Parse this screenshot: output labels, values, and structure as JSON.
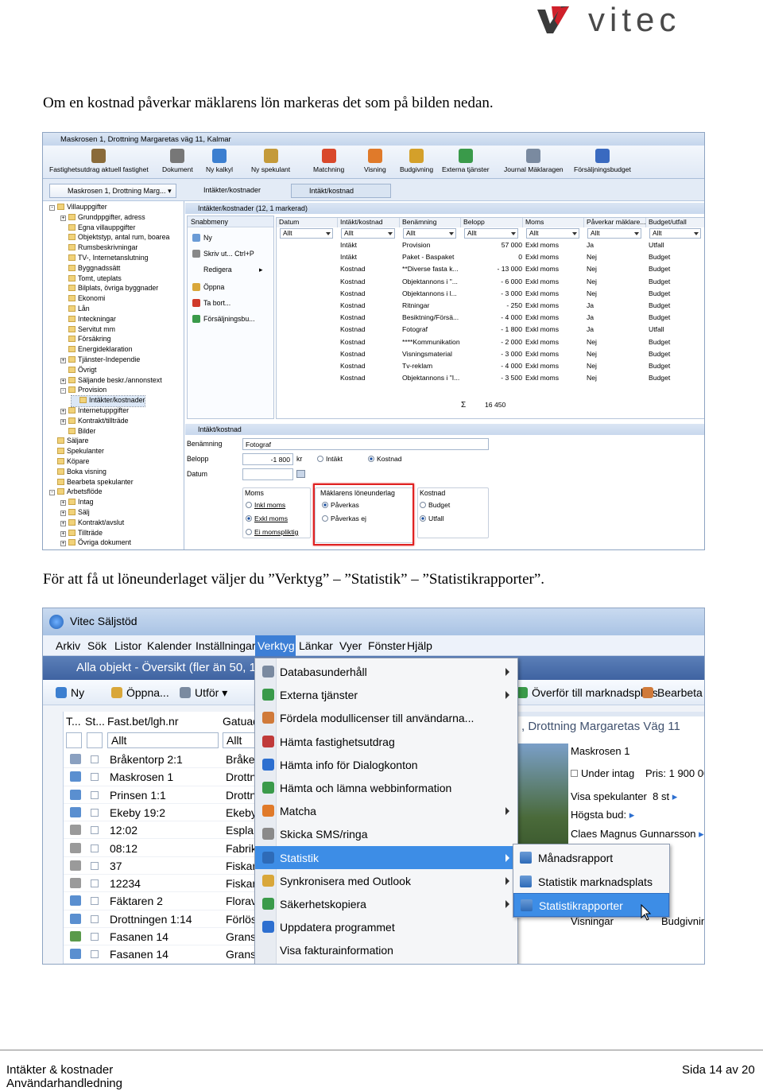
{
  "logo": {
    "text": "vitec",
    "brand_color": "#d0202a",
    "text_color": "#4a4a4a"
  },
  "paragraph_1": "Om en kostnad påverkar mäklarens lön markeras det som på bilden nedan.",
  "paragraph_2": "För att få ut löneunderlaget väljer du ”Verktyg” – ”Statistik” – ”Statistikrapporter”.",
  "shot1": {
    "title": "Maskrosen 1, Drottning Margaretas väg 11, Kalmar",
    "toolbar": [
      "Fastighetsutdrag aktuell fastighet",
      "Dokument",
      "Ny kalkyl",
      "Ny spekulant",
      "Matchning",
      "Visning",
      "Budgivning",
      "Externa tjänster",
      "Journal Mäklaragen",
      "Försäljningsbudget"
    ],
    "nav_object": "Maskrosen 1, Drottning Marg...",
    "nav_tab1": "Intäkter/kostnader",
    "nav_tab2": "Intäkt/kostnad",
    "tree": [
      {
        "label": "Villauppgifter",
        "lvl": 0,
        "box": "-"
      },
      {
        "label": "Grundppgifter, adress",
        "lvl": 1,
        "box": "+"
      },
      {
        "label": "Egna villauppgifter",
        "lvl": 1,
        "box": ""
      },
      {
        "label": "Objektstyp, antal rum, boarea",
        "lvl": 1,
        "box": ""
      },
      {
        "label": "Rumsbeskrivningar",
        "lvl": 1,
        "box": ""
      },
      {
        "label": "TV-, Internetanslutning",
        "lvl": 1,
        "box": ""
      },
      {
        "label": "Byggnadssätt",
        "lvl": 1,
        "box": ""
      },
      {
        "label": "Tomt, uteplats",
        "lvl": 1,
        "box": ""
      },
      {
        "label": "Bilplats, övriga byggnader",
        "lvl": 1,
        "box": ""
      },
      {
        "label": "Ekonomi",
        "lvl": 1,
        "box": ""
      },
      {
        "label": "Lån",
        "lvl": 1,
        "box": ""
      },
      {
        "label": "Inteckningar",
        "lvl": 1,
        "box": ""
      },
      {
        "label": "Servitut mm",
        "lvl": 1,
        "box": ""
      },
      {
        "label": "Försäkring",
        "lvl": 1,
        "box": ""
      },
      {
        "label": "Energideklaration",
        "lvl": 1,
        "box": ""
      },
      {
        "label": "Tjänster-Independie",
        "lvl": 1,
        "box": "+"
      },
      {
        "label": "Övrigt",
        "lvl": 1,
        "box": ""
      },
      {
        "label": "Säljande beskr./annonstext",
        "lvl": 1,
        "box": "+"
      },
      {
        "label": "Provision",
        "lvl": 1,
        "box": "-"
      },
      {
        "label": "Intäkter/kostnader",
        "lvl": 2,
        "box": ""
      },
      {
        "label": "Internetuppgifter",
        "lvl": 1,
        "box": "+"
      },
      {
        "label": "Kontrakt/tillträde",
        "lvl": 1,
        "box": "+"
      },
      {
        "label": "Bilder",
        "lvl": 1,
        "box": ""
      },
      {
        "label": "Säljare",
        "lvl": 0,
        "box": ""
      },
      {
        "label": "Spekulanter",
        "lvl": 0,
        "box": ""
      },
      {
        "label": "Köpare",
        "lvl": 0,
        "box": ""
      },
      {
        "label": "Boka visning",
        "lvl": 0,
        "box": ""
      },
      {
        "label": "Bearbeta spekulanter",
        "lvl": 0,
        "box": ""
      },
      {
        "label": "Arbetsflöde",
        "lvl": 0,
        "box": "-"
      },
      {
        "label": "Intag",
        "lvl": 1,
        "box": "+"
      },
      {
        "label": "Sälj",
        "lvl": 1,
        "box": "+"
      },
      {
        "label": "Kontrakt/avslut",
        "lvl": 1,
        "box": "+"
      },
      {
        "label": "Tillträde",
        "lvl": 1,
        "box": "+"
      },
      {
        "label": "Övriga dokument",
        "lvl": 1,
        "box": "+"
      }
    ],
    "subhead": "Intäkter/kostnader (12, 1 markerad)",
    "quick_title": "Snabbmeny",
    "quick": [
      "Ny",
      "Skriv ut...  Ctrl+P",
      "Redigera",
      "Öppna",
      "Ta bort...",
      "Försäljningsbu..."
    ],
    "grid_headers": [
      "Datum",
      "Intäkt/kostnad",
      "Benämning",
      "Belopp",
      "Moms",
      "Påverkar mäklare...",
      "Budget/utfall"
    ],
    "filter": "Allt",
    "grid_rows": [
      [
        "Intäkt",
        "Provision",
        "57 000",
        "Exkl moms",
        "Ja",
        "Utfall"
      ],
      [
        "Intäkt",
        "Paket - Baspaket",
        "0",
        "Exkl moms",
        "Nej",
        "Budget"
      ],
      [
        "Kostnad",
        "**Diverse fasta k...",
        "- 13 000",
        "Exkl moms",
        "Nej",
        "Budget"
      ],
      [
        "Kostnad",
        "Objektannons i \"...",
        "- 6 000",
        "Exkl moms",
        "Nej",
        "Budget"
      ],
      [
        "Kostnad",
        "Objektannons i l...",
        "- 3 000",
        "Exkl moms",
        "Nej",
        "Budget"
      ],
      [
        "Kostnad",
        "Ritningar",
        "- 250",
        "Exkl moms",
        "Ja",
        "Budget"
      ],
      [
        "Kostnad",
        "Besiktning/Försä...",
        "- 4 000",
        "Exkl moms",
        "Ja",
        "Budget"
      ],
      [
        "Kostnad",
        "Fotograf",
        "- 1 800",
        "Exkl moms",
        "Ja",
        "Utfall"
      ],
      [
        "Kostnad",
        "****Kommunikation",
        "- 2 000",
        "Exkl moms",
        "Nej",
        "Budget"
      ],
      [
        "Kostnad",
        "Visningsmaterial",
        "- 3 000",
        "Exkl moms",
        "Nej",
        "Budget"
      ],
      [
        "Kostnad",
        "Tv-reklam",
        "- 4 000",
        "Exkl moms",
        "Nej",
        "Budget"
      ],
      [
        "Kostnad",
        "Objektannons i \"I...",
        "- 3 500",
        "Exkl moms",
        "Nej",
        "Budget"
      ]
    ],
    "sum_symbol": "Σ",
    "sum": "16 450",
    "detail_title": "Intäkt/kostnad",
    "lbl_benamning": "Benämning",
    "val_benamning": "Fotograf",
    "lbl_belopp": "Belopp",
    "val_belopp": "-1 800",
    "unit_kr": "kr",
    "radio_intakt": "Intäkt",
    "radio_kostnad": "Kostnad",
    "lbl_datum": "Datum",
    "grp_moms": "Moms",
    "moms_opts": [
      "Inkl moms",
      "Exkl moms",
      "Ei momspliktig"
    ],
    "grp_loneunderlag": "Mäklarens löneunderlag",
    "lone_opts": [
      "Påverkas",
      "Påverkas ej"
    ],
    "grp_kostnad": "Kostnad",
    "kostnad_opts": [
      "Budget",
      "Utfall"
    ]
  },
  "shot2": {
    "title": "Vitec Säljstöd",
    "menu": [
      "Arkiv",
      "Sök",
      "Listor",
      "Kalender",
      "Inställningar",
      "Verktyg",
      "Länkar",
      "Vyer",
      "Fönster",
      "Hjälp"
    ],
    "band": "Alla objekt - Översikt (fler än 50, 1 m",
    "toolbar": [
      "Ny",
      "Öppna...",
      "Utför"
    ],
    "toolbar_right": [
      "Överför till marknadsplats",
      "Bearbeta s"
    ],
    "list_headers": [
      "T...",
      "St...",
      "Fast.bet/lgh.nr",
      "Gatuad"
    ],
    "list_filter": "Allt",
    "rows": [
      [
        "Bråkentorp 2:1",
        "Bråken"
      ],
      [
        "Maskrosen 1",
        "Drottni"
      ],
      [
        "Prinsen 1:1",
        "Drottni"
      ],
      [
        "Ekeby 19:2",
        "Ekeby"
      ],
      [
        "12:02",
        "Esplan"
      ],
      [
        "08:12",
        "Fabriks"
      ],
      [
        "37",
        "Fiskare"
      ],
      [
        "12234",
        "Fiskare"
      ],
      [
        "Fäktaren 2",
        "Florava"
      ],
      [
        "Drottningen 1:14",
        "Förlösa"
      ],
      [
        "Fasanen 14",
        "Granst"
      ],
      [
        "Fasanen 14",
        "Granst"
      ]
    ],
    "dropdown": [
      {
        "label": "Databasunderhåll",
        "arrow": true
      },
      {
        "label": "Externa tjänster",
        "arrow": true
      },
      {
        "label": "Fördela modullicenser till användarna...",
        "arrow": false
      },
      {
        "label": "Hämta fastighetsutdrag",
        "arrow": false
      },
      {
        "label": "Hämta info för Dialogkonton",
        "arrow": false
      },
      {
        "label": "Hämta och lämna webbinformation",
        "arrow": false
      },
      {
        "label": "Matcha",
        "arrow": true
      },
      {
        "label": "Skicka SMS/ringa",
        "arrow": false
      },
      {
        "label": "Statistik",
        "arrow": true
      },
      {
        "label": "Synkronisera med Outlook",
        "arrow": true
      },
      {
        "label": "Säkerhetskopiera",
        "arrow": true
      },
      {
        "label": "Uppdatera programmet",
        "arrow": false
      },
      {
        "label": "Visa fakturainformation",
        "arrow": false
      }
    ],
    "submenu": [
      "Månadsrapport",
      "Statistik marknadsplats",
      "Statistikrapporter"
    ],
    "right_title": ", Drottning Margaretas Väg 11",
    "right_obj": "Maskrosen 1",
    "right_intag": "Under intag",
    "right_pris": "Pris: 1 900 00",
    "right_spek": "Visa spekulanter",
    "right_spek_n": "8 st",
    "right_bud": "Högsta bud:",
    "right_agent": "Claes Magnus Gunnarsson",
    "right_visningar": "Visningar",
    "right_budgivn": "Budgivnin"
  },
  "footer": {
    "left1": "Intäkter & kostnader",
    "left2": "Användarhandledning",
    "page": "Sida 14 av 20"
  }
}
